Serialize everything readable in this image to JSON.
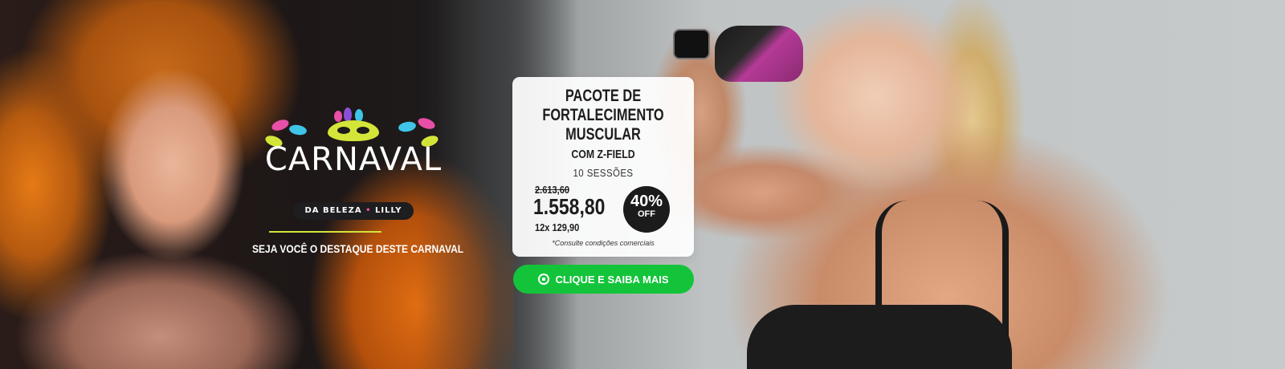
{
  "logo": {
    "title": "CARNAVAL",
    "subtitle_left": "DA BELEZA",
    "subtitle_dot": "•",
    "subtitle_right": "LILLY"
  },
  "tagline": "SEJA VOCÊ O DESTAQUE DESTE CARNAVAL",
  "offer": {
    "title_line1": "PACOTE DE",
    "title_line2": "FORTALECIMENTO",
    "title_line3": "MUSCULAR",
    "subtitle": "COM Z-FIELD",
    "sessions": "10 SESSÕES",
    "old_price": "2.613,60",
    "new_price": "1.558,80",
    "installments": "12x 129,90",
    "discount_pct": "40%",
    "discount_off": "OFF",
    "fine_print": "*Consulte condições comerciais"
  },
  "cta": {
    "label": "CLIQUE E SAIBA MAIS",
    "icon": "whatsapp-icon"
  },
  "colors": {
    "accent_green": "#13c43b",
    "logo_lime": "#d4e53a",
    "logo_pink": "#e84fa6",
    "dark": "#1b1b1b"
  }
}
